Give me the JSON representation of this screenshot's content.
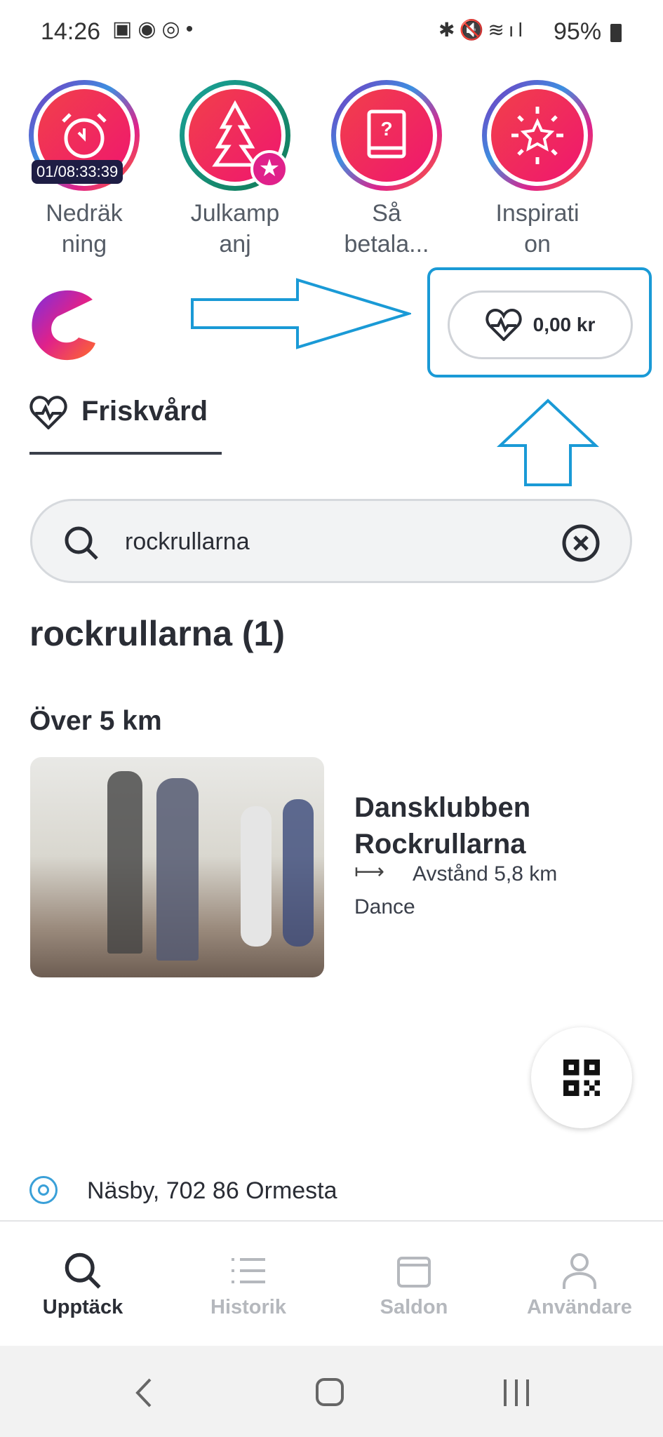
{
  "status_bar": {
    "time": "14:26",
    "battery": "95%"
  },
  "stories": [
    {
      "label_line1": "Nedräk",
      "label_line2": "ning",
      "badge": "01/08:33:39",
      "icon": "alarm-clock-icon"
    },
    {
      "label_line1": "Julkamp",
      "label_line2": "anj",
      "icon": "christmas-tree-icon"
    },
    {
      "label_line1": "Så",
      "label_line2": "betala...",
      "icon": "help-book-icon"
    },
    {
      "label_line1": "Inspirati",
      "label_line2": "on",
      "icon": "star-burst-icon"
    }
  ],
  "balance": {
    "amount": "0,00 kr",
    "icon": "heart-pulse-icon"
  },
  "tab": {
    "label": "Friskvård"
  },
  "search": {
    "value": "rockrullarna",
    "placeholder": ""
  },
  "results": {
    "heading": "rockrullarna (1)",
    "section": "Över 5 km",
    "items": [
      {
        "title_line1": "Dansklubben",
        "title_line2": "Rockrullarna",
        "distance": "Avstånd 5,8 km",
        "category": "Dance"
      }
    ]
  },
  "location": "Näsby, 702 86 Ormesta",
  "bottom_nav": [
    {
      "label": "Upptäck"
    },
    {
      "label": "Historik"
    },
    {
      "label": "Saldon"
    },
    {
      "label": "Användare"
    }
  ],
  "colors": {
    "accent": "#f0166f",
    "annotation": "#1a9ad6",
    "text": "#2a2d35"
  }
}
